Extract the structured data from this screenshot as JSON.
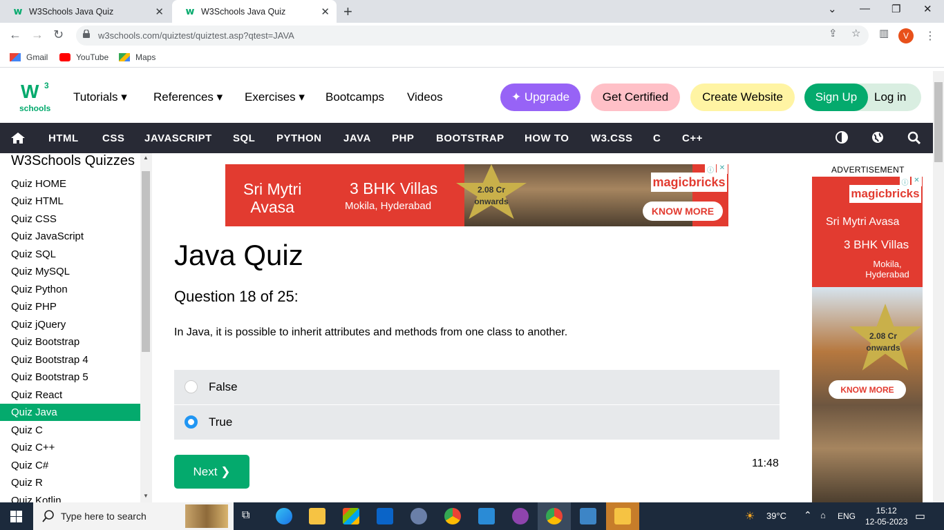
{
  "browser": {
    "tabs": [
      {
        "title": "W3Schools Java Quiz",
        "active": false
      },
      {
        "title": "W3Schools Java Quiz",
        "active": true
      }
    ],
    "url": "w3schools.com/quiztest/quiztest.asp?qtest=JAVA",
    "profile_initial": "V",
    "bookmarks": [
      "Gmail",
      "YouTube",
      "Maps"
    ]
  },
  "header": {
    "logo_mark": "W",
    "logo_sup": "3",
    "logo_text": "schools",
    "menu": [
      "Tutorials",
      "References",
      "Exercises",
      "Bootcamps",
      "Videos"
    ],
    "buttons": {
      "upgrade": "Upgrade",
      "certified": "Get Certified",
      "create": "Create Website",
      "signup": "Sign Up",
      "login": "Log in"
    }
  },
  "topnav": [
    "HTML",
    "CSS",
    "JAVASCRIPT",
    "SQL",
    "PYTHON",
    "JAVA",
    "PHP",
    "BOOTSTRAP",
    "HOW TO",
    "W3.CSS",
    "C",
    "C++"
  ],
  "sidebar": {
    "heading": "W3Schools Quizzes",
    "items": [
      "Quiz HOME",
      "Quiz HTML",
      "Quiz CSS",
      "Quiz JavaScript",
      "Quiz SQL",
      "Quiz MySQL",
      "Quiz Python",
      "Quiz PHP",
      "Quiz jQuery",
      "Quiz Bootstrap",
      "Quiz Bootstrap 4",
      "Quiz Bootstrap 5",
      "Quiz React",
      "Quiz Java",
      "Quiz C",
      "Quiz C++",
      "Quiz C#",
      "Quiz R",
      "Quiz Kotlin"
    ],
    "active_item": "Quiz Java"
  },
  "ad_top": {
    "name_line1": "Sri Mytri",
    "name_line2": "Avasa",
    "config": "3 BHK Villas",
    "location": "Mokila, Hyderabad",
    "price_line1": "2.08 Cr",
    "price_line2": "onwards",
    "brand": "magicbricks",
    "cta": "KNOW MORE"
  },
  "quiz": {
    "title": "Java Quiz",
    "progress": "Question 18 of 25:",
    "question": "In Java, it is possible to inherit attributes and methods from one class to another.",
    "options": [
      {
        "label": "False",
        "selected": false
      },
      {
        "label": "True",
        "selected": true
      }
    ],
    "next_label": "Next ❯",
    "timer": "11:48"
  },
  "ad_right": {
    "label": "ADVERTISEMENT",
    "brand": "magicbricks",
    "name": "Sri Mytri Avasa",
    "config": "3 BHK Villas",
    "loc_line1": "Mokila,",
    "loc_line2": "Hyderabad",
    "price_line1": "2.08 Cr",
    "price_line2": "onwards",
    "cta": "KNOW MORE"
  },
  "taskbar": {
    "search_placeholder": "Type here to search",
    "weather": "39°C",
    "lang": "ENG",
    "time": "15:12",
    "date": "12-05-2023"
  },
  "colors": {
    "w3_green": "#04aa6d",
    "nav_dark": "#282a35",
    "upgrade_purple": "#9763f6",
    "certified_pink": "#ffc0c7",
    "create_yellow": "#fff4a3",
    "login_mint": "#d9eee1",
    "ad_red": "#e23b30",
    "radio_blue": "#2196f3"
  }
}
